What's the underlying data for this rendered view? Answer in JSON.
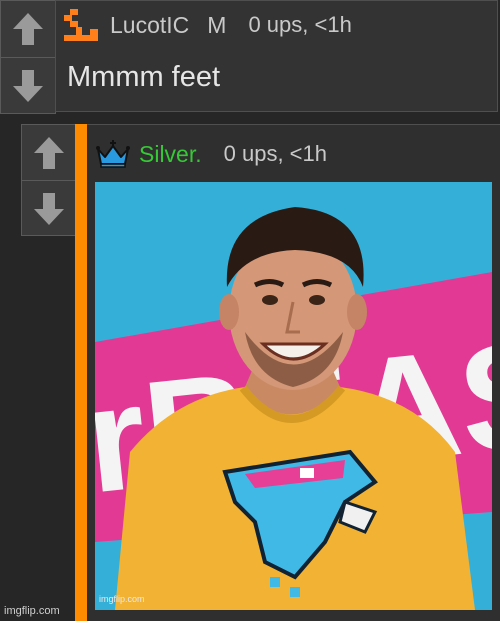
{
  "comment1": {
    "username": "LucotIC",
    "badge": "M",
    "meta": "0 ups, <1h",
    "body": "Mmmm feet",
    "user_icon": "orange-pixel-L-icon",
    "username_color": "#c9c9c9"
  },
  "comment2": {
    "username": "Silver.",
    "meta": "0 ups, <1h",
    "user_icon": "crown-icon",
    "username_color": "#36c836",
    "thread_color": "#ff8c00",
    "image": {
      "subject": "smiling man in yellow t-shirt",
      "background_text": "rBEAS",
      "watermark": "imgflip.com"
    }
  },
  "votes": {
    "up_icon": "arrow-up-icon",
    "down_icon": "arrow-down-icon"
  },
  "footer": {
    "watermark": "imgflip.com"
  },
  "colors": {
    "page_bg": "#262626",
    "panel_bg": "#333333",
    "accent": "#ff8c00",
    "image_bg": "#36b2d6"
  }
}
